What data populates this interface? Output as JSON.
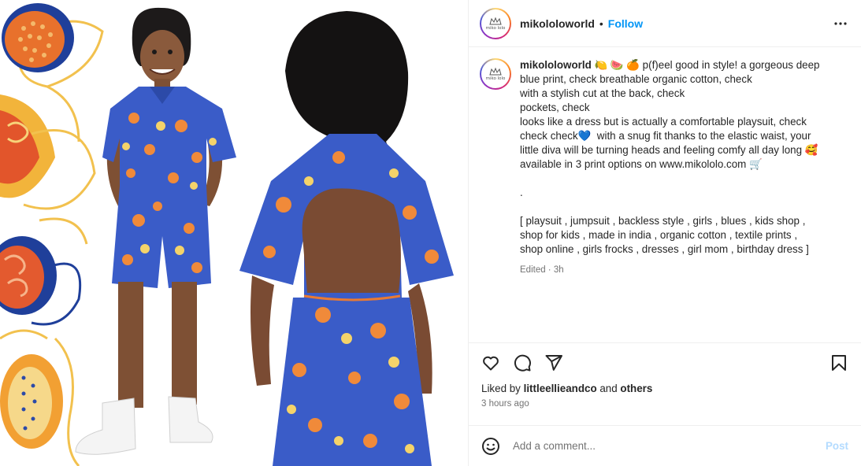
{
  "media": {
    "alt_description": ""
  },
  "header": {
    "username": "mikololoworld",
    "separator": "•",
    "follow_label": "Follow",
    "avatar_text": "miko lolo"
  },
  "caption": {
    "username": "mikololoworld",
    "lines": [
      " 🍋 🍉 🍊 p(f)eel good in style! a gorgeous deep",
      "blue print, check breathable organic cotton, check",
      "with a stylish cut at the back, check",
      "pockets, check",
      "looks like a dress but is actually a comfortable playsuit, check",
      "check check💙  with a snug fit thanks to the elastic waist, your",
      "little diva will be turning heads and feeling comfy all day long 🥰",
      "available in 3 print options on www.mikololo.com 🛒",
      "",
      ".",
      "",
      "[ playsuit , jumpsuit , backless style , girls , blues , kids shop ,",
      "shop for kids , made in india , organic cotton , textile prints ,",
      "shop online , girls frocks , dresses , girl mom , birthday dress ]"
    ],
    "meta": "Edited · 3h"
  },
  "actions": {
    "like_icon": "heart-icon",
    "comment_icon": "comment-icon",
    "share_icon": "send-icon",
    "save_icon": "bookmark-icon"
  },
  "likes": {
    "prefix": "Liked by ",
    "user": "littleellieandco",
    "middle": " and ",
    "others": "others"
  },
  "timestamp": "3 hours ago",
  "comment": {
    "placeholder": "Add a comment...",
    "post_label": "Post"
  },
  "colors": {
    "accent": "#0095f6",
    "post_disabled": "#b3dbff",
    "muted": "#737373",
    "divider": "#efefef",
    "print_blue": "#3a5cc8"
  }
}
